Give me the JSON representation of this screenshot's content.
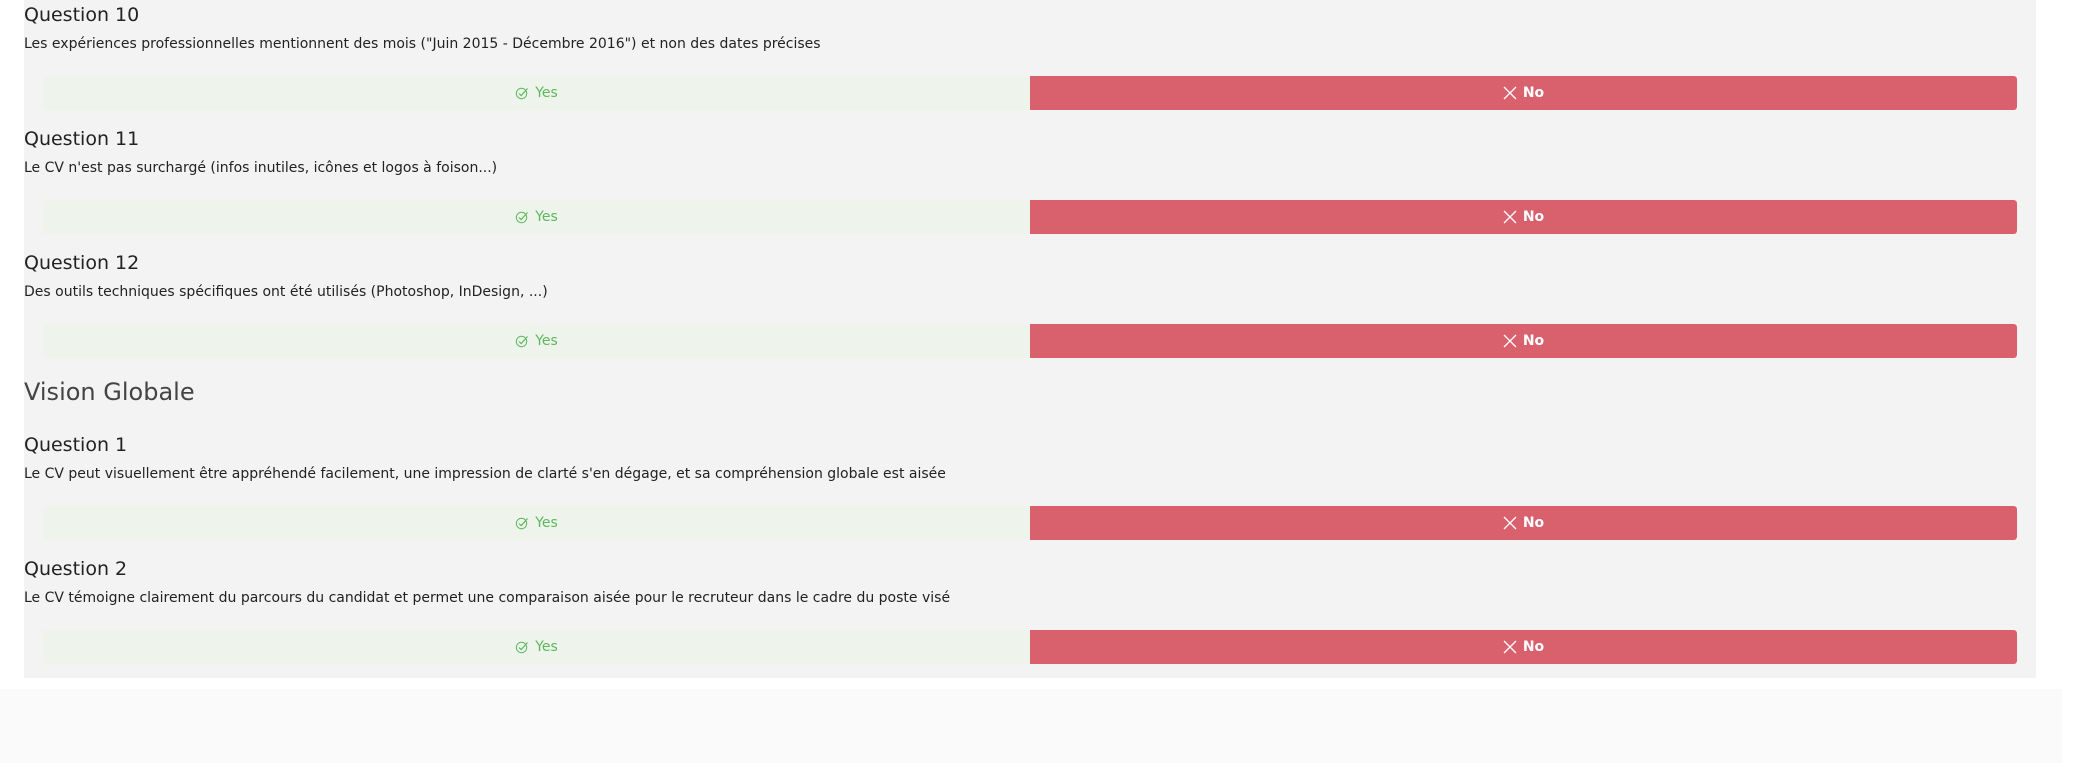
{
  "blocks": [
    {
      "type": "question",
      "title": "Question 10",
      "text": "Les expériences professionnelles mentionnent des mois (\"Juin 2015 - Décembre 2016\") et non des dates précises",
      "yes_label": "Yes",
      "no_label": "No",
      "selected": "no"
    },
    {
      "type": "question",
      "title": "Question 11",
      "text": "Le CV n'est pas surchargé (infos inutiles, icônes et logos à foison...)",
      "yes_label": "Yes",
      "no_label": "No",
      "selected": "no"
    },
    {
      "type": "question",
      "title": "Question 12",
      "text": "Des outils techniques spécifiques ont été utilisés (Photoshop, InDesign, ...)",
      "yes_label": "Yes",
      "no_label": "No",
      "selected": "no"
    },
    {
      "type": "section",
      "title": "Vision Globale"
    },
    {
      "type": "question",
      "title": "Question 1",
      "text": "Le CV peut visuellement être appréhendé facilement, une impression de clarté s'en dégage, et sa compréhension globale est aisée",
      "yes_label": "Yes",
      "no_label": "No",
      "selected": "no"
    },
    {
      "type": "question",
      "title": "Question 2",
      "text": "Le CV témoigne clairement du parcours du candidat et permet une comparaison aisée pour le recruteur dans le cadre du poste visé",
      "yes_label": "Yes",
      "no_label": "No",
      "selected": "no"
    }
  ],
  "icons": {
    "yes": "check-circle-icon",
    "no": "close-icon"
  },
  "colors": {
    "no_selected": "#d9606d",
    "yes_unselected": "#eef3ec",
    "yes_text": "#5cb85c"
  }
}
